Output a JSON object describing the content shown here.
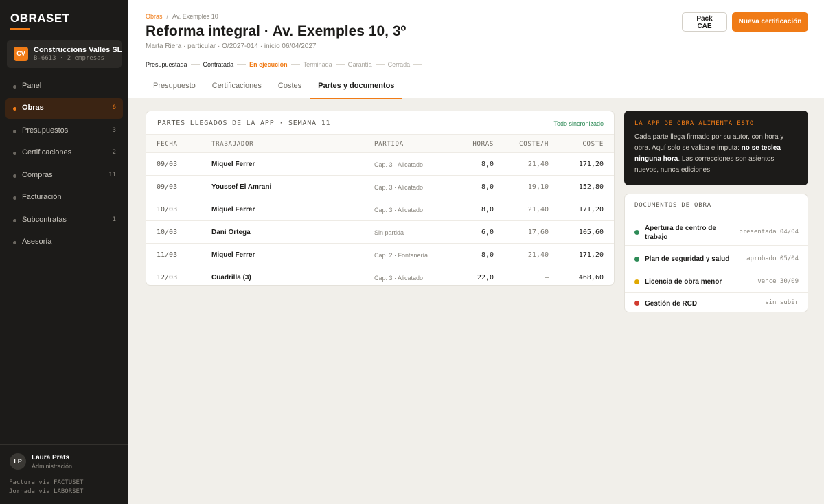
{
  "sidebar": {
    "logo": "OBRASET",
    "company": {
      "badge": "CV",
      "name": "Construccions Vallès SL",
      "sub": "B-6613 · 2 empresas"
    },
    "items": [
      {
        "label": "Panel",
        "count": ""
      },
      {
        "label": "Obras",
        "count": "6"
      },
      {
        "label": "Presupuestos",
        "count": "3"
      },
      {
        "label": "Certificaciones",
        "count": "2"
      },
      {
        "label": "Compras",
        "count": "11"
      },
      {
        "label": "Facturación",
        "count": ""
      },
      {
        "label": "Subcontratas",
        "count": "1"
      },
      {
        "label": "Asesoría",
        "count": ""
      }
    ],
    "user": {
      "initials": "LP",
      "name": "Laura Prats",
      "role": "Administración"
    },
    "footer": [
      "Factura vía FACTUSET",
      "Jornada vía LABORSET"
    ]
  },
  "header": {
    "breadcrumb": {
      "root": "Obras",
      "sep": "/",
      "current": "Av. Exemples 10"
    },
    "title": "Reforma integral · Av. Exemples 10, 3º",
    "subtitle": "Marta Riera · particular · O/2027-014 · inicio 06/04/2027",
    "stages": [
      {
        "label": "Presupuestada",
        "state": "done"
      },
      {
        "label": "Contratada",
        "state": "done"
      },
      {
        "label": "En ejecución",
        "state": "current"
      },
      {
        "label": "Terminada",
        "state": "pending"
      },
      {
        "label": "Garantía",
        "state": "pending"
      },
      {
        "label": "Cerrada",
        "state": "pending"
      }
    ],
    "tabs": [
      "Presupuesto",
      "Certificaciones",
      "Costes",
      "Partes y documentos"
    ],
    "active_tab": 3,
    "pack_button": [
      "Pack",
      "CAE"
    ],
    "primary_button": "Nueva certificación"
  },
  "partes": {
    "title": "PARTES LLEGADOS DE LA APP · SEMANA 11",
    "sync": "Todo sincronizado",
    "columns": {
      "date": "FECHA",
      "worker": "TRABAJADOR",
      "part": "PARTIDA",
      "hours": "HORAS",
      "rate": "COSTE/H",
      "cost": "COSTE"
    },
    "rows": [
      {
        "date": "09/03",
        "worker": "Miquel Ferrer",
        "part": "Cap. 3 · Alicatado",
        "hours": "8,0",
        "rate": "21,40",
        "cost": "171,20"
      },
      {
        "date": "09/03",
        "worker": "Youssef El Amrani",
        "part": "Cap. 3 · Alicatado",
        "hours": "8,0",
        "rate": "19,10",
        "cost": "152,80"
      },
      {
        "date": "10/03",
        "worker": "Miquel Ferrer",
        "part": "Cap. 3 · Alicatado",
        "hours": "8,0",
        "rate": "21,40",
        "cost": "171,20"
      },
      {
        "date": "10/03",
        "worker": "Dani Ortega",
        "part": "Sin partida",
        "hours": "6,0",
        "rate": "17,60",
        "cost": "105,60"
      },
      {
        "date": "11/03",
        "worker": "Miquel Ferrer",
        "part": "Cap. 2 · Fontanería",
        "hours": "8,0",
        "rate": "21,40",
        "cost": "171,20"
      },
      {
        "date": "12/03",
        "worker": "Cuadrilla (3)",
        "part": "Cap. 3 · Alicatado",
        "hours": "22,0",
        "rate": "—",
        "cost": "468,60"
      }
    ]
  },
  "info": {
    "title": "LA APP DE OBRA ALIMENTA ESTO",
    "text_1": "Cada parte llega firmado por su autor, con hora y obra. Aquí solo se valida e imputa: ",
    "text_bold": "no se teclea ninguna hora",
    "text_2": ". Las correcciones son asientos nuevos, nunca ediciones."
  },
  "docs": {
    "title": "DOCUMENTOS DE OBRA",
    "items": [
      {
        "name": "Apertura de centro de trabajo",
        "status": "presentada 04/04",
        "color": "#2e8b57"
      },
      {
        "name": "Plan de seguridad y salud",
        "status": "aprobado 05/04",
        "color": "#2e8b57"
      },
      {
        "name": "Licencia de obra menor",
        "status": "vence 30/09",
        "color": "#e0a800"
      },
      {
        "name": "Gestión de RCD",
        "status": "sin subir",
        "color": "#d13b2f"
      }
    ]
  },
  "colors": {
    "accent": "#f07b16",
    "sidebar": "#1c1b19",
    "ok": "#2e8b57",
    "warn": "#e0a800",
    "error": "#d13b2f"
  }
}
